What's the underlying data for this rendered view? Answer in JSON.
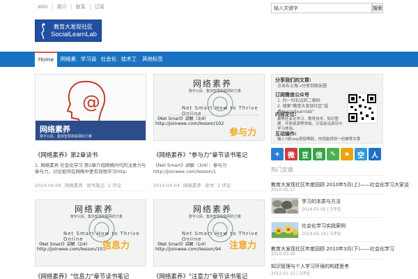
{
  "topbar": {
    "links": [
      "Wiki",
      "简介",
      "联系",
      "订阅"
    ],
    "search_value": "输入关键字",
    "search_button": "搜索"
  },
  "logo": {
    "line1": "教育大发现社区",
    "line2": "SocialLearnLab"
  },
  "nav": {
    "items": [
      "Home",
      "网络素养",
      "学习设计",
      "社会化学习",
      "技术工具",
      "其他标签"
    ],
    "dropdown_marker": "▾"
  },
  "posts": [
    {
      "title": "《网络素养》第2章读书",
      "excerpt": "1. 网络素养 社会化学习 第2章介绍网络时代的注意力与参与力，讨论如何在网络中更有效地学习http:",
      "date": "2014-04-08",
      "category": "网络素养",
      "tag": "读书笔记",
      "comments": "2 评论",
      "thumb_caption": "网络素养",
      "thumb_sub": "数字公民、集体智慧和联网的力量",
      "thumb_label": ""
    },
    {
      "title": "《网络素养》\"参与力\"章节读书笔记",
      "excerpt": "《Net Smart》讲解（3/4）：参与力http://joinwee.com/lesson/1",
      "date": "2014-04-04",
      "category": "网络素养",
      "tag": "读书",
      "comments": "2 评论",
      "thumb_caption": "网络素养",
      "thumb_sub": "数字公民、集体智慧和联网的力量",
      "thumb_label": "参与力",
      "thumb_overlay": "《Net Smart》讲解（3/4）",
      "thumb_url": "http://joinwee.com/lesson/102"
    },
    {
      "title": "《网络素养》\"信息力\"章节读书笔记",
      "date": "",
      "thumb_caption": "网络素养",
      "thumb_sub": "数字公民、集体智慧和联网的力量",
      "thumb_label": "信息力",
      "thumb_overlay": "《Net Smart》讲解（2/4）",
      "thumb_url": "http://joinwee.com/lesson/101"
    },
    {
      "title": "《网络素养》\"注意力\"章节读书笔记",
      "date": "",
      "thumb_caption": "网络素养",
      "thumb_sub": "数字公民、集体智慧和联网的力量",
      "thumb_label": "注意力",
      "thumb_overlay": "《Net Smart》讲解（1/4）",
      "thumb_url": "http://joinwee.com/lesson/94"
    }
  ],
  "thumb_english": "Net Smart How to Thrive Online",
  "sidebar": {
    "share_heading": "分享我们的文章:",
    "share_text": "点击右上角→分享到朋友圈",
    "share_text_red": "分享到朋友圈",
    "wechat_heading": "订阅微信公众号",
    "wechat_text1": "1. 扫一扫右边的二维码",
    "wechat_text2": "2. 搜索\"教育大发现社区\"或者\"sociallearnlab\"",
    "content_heading": "内容定位:",
    "content_text": "聚焦社会化学习、教育技术、知识管理、开放资源等领域，分享前沿资讯与学习体验。",
    "interact_heading": "互动操作:",
    "interact_text": "输入?或help获取帮助，你就能得到一份推荐文章",
    "share_icons": [
      {
        "glyph": "+",
        "color": "#2a7fd4"
      },
      {
        "glyph": "微",
        "color": "#d13c3c"
      },
      {
        "glyph": "豆",
        "color": "#2f9e44"
      },
      {
        "glyph": "信",
        "color": "#3aa34a"
      },
      {
        "glyph": "✎",
        "color": "#4caf50"
      },
      {
        "glyph": "★",
        "color": "#f0a20b"
      },
      {
        "glyph": "空",
        "color": "#2d9bd9"
      },
      {
        "glyph": "人",
        "color": "#1e6fc8"
      }
    ],
    "popular_heading": "热门文章",
    "popular": [
      {
        "title": "教育大发现社区年度回顾 2010年5月(上)——社会化学习大家谈",
        "date": "2010-05-17",
        "comments": "",
        "has_thumb": false
      },
      {
        "title": "学习的本质与方法",
        "date": "2014-01-05",
        "comments": "5评论",
        "has_thumb": true
      },
      {
        "title": "社会化学习实践案例",
        "date": "2014-02-14",
        "comments": "5评论",
        "has_thumb": true
      },
      {
        "title": "教育大发现社区年度回顾 2010年3月(下)——社会化学习",
        "date": "2010-03-30",
        "comments": "",
        "has_thumb": false
      },
      {
        "title": "知识管理与个人学习环境的构建思考",
        "date": "2012-01-15",
        "comments": "5评论",
        "has_thumb": false
      }
    ]
  },
  "colors": {
    "nav": "#1a73c2",
    "logo": "#1f4fa3",
    "thumb_label": "#f5a623"
  }
}
